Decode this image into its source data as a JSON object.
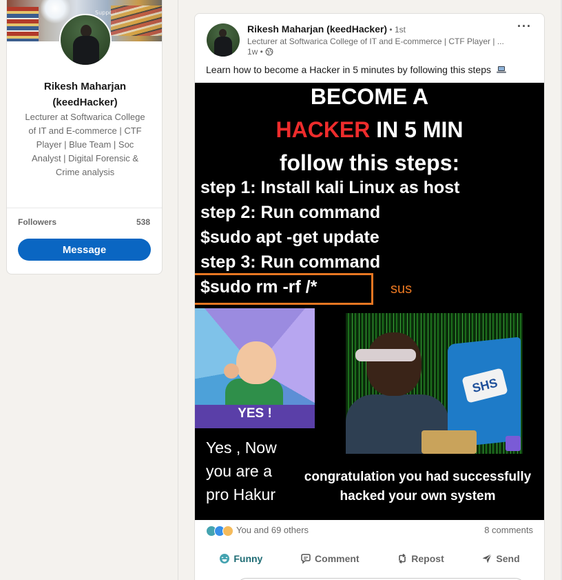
{
  "profile": {
    "name_line1": "Rikesh Maharjan",
    "name_line2": "(keedHacker)",
    "headline": "Lecturer at Softwarica College of IT and E-commerce | CTF Player | Blue Team | Soc Analyst | Digital Forensic & Crime analysis",
    "banner_sign": "Support",
    "followers_label": "Followers",
    "followers_count": "538",
    "message_label": "Message"
  },
  "post": {
    "author_name": "Rikesh Maharjan (keedHacker)",
    "author_degree": " • 1st",
    "author_headline": "Lecturer at Softwarica College of IT and E-commerce | CTF Player | ...",
    "time": "1w •",
    "more_label": "···",
    "text": "Learn how to become a Hacker in 5 minutes by following this steps",
    "image": {
      "title_line1": "BECOME A",
      "title_line2_red": "HACKER",
      "title_line2_rest": " IN 5 MIN",
      "title_line3": "follow this steps:",
      "step1": "step 1: Install kali Linux as host",
      "step2": "step 2: Run command",
      "cmd1": "$sudo apt -get update",
      "step3": "step 3: Run command",
      "cmd2": "$sudo rm -rf /*",
      "annotation": "sus",
      "yes_label": "YES !",
      "laptop_logo": "SHS",
      "pro_line1": "Yes , Now",
      "pro_line2": "you are a",
      "pro_line3": "pro Hakur",
      "congrats_line1": "congratulation you had successfully",
      "congrats_line2": "hacked your own system",
      "accent_red": "#ee2c2c",
      "annotation_color": "#e87722"
    },
    "reactors": "You and 69 others",
    "comments": "8 comments",
    "actions": {
      "funny": "Funny",
      "comment": "Comment",
      "repost": "Repost",
      "send": "Send"
    }
  },
  "colors": {
    "brand": "#0a66c2",
    "funny": "#1d6b73",
    "page_bg": "#f4f2ee"
  }
}
